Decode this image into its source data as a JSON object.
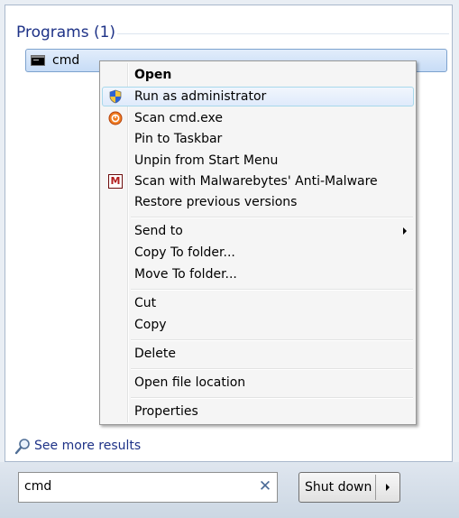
{
  "results": {
    "section_title": "Programs (1)",
    "items": [
      {
        "label": "cmd",
        "icon": "command-prompt-icon"
      }
    ]
  },
  "context_menu": {
    "items": [
      {
        "label": "Open",
        "bold": true
      },
      {
        "label": "Run as administrator",
        "icon": "uac-shield-icon",
        "highlighted": true
      },
      {
        "label": "Scan cmd.exe",
        "icon": "antivirus-scan-icon"
      },
      {
        "label": "Pin to Taskbar"
      },
      {
        "label": "Unpin from Start Menu"
      },
      {
        "label": "Scan with Malwarebytes' Anti-Malware",
        "icon": "malwarebytes-icon"
      },
      {
        "label": "Restore previous versions"
      },
      {
        "label": "Send to",
        "submenu": true
      },
      {
        "label": "Copy To folder..."
      },
      {
        "label": "Move To folder..."
      },
      {
        "label": "Cut"
      },
      {
        "label": "Copy"
      },
      {
        "label": "Delete"
      },
      {
        "label": "Open file location"
      },
      {
        "label": "Properties"
      }
    ]
  },
  "see_more": {
    "label": "See more results",
    "icon": "magnifier-icon"
  },
  "search": {
    "value": "cmd",
    "clear_icon": "clear-x-icon"
  },
  "shutdown": {
    "label": "Shut down",
    "arrow_icon": "chevron-right-icon"
  },
  "colors": {
    "accent_text": "#1e3287",
    "selection": "#c7dcf6",
    "menu_background": "#f5f5f5"
  }
}
